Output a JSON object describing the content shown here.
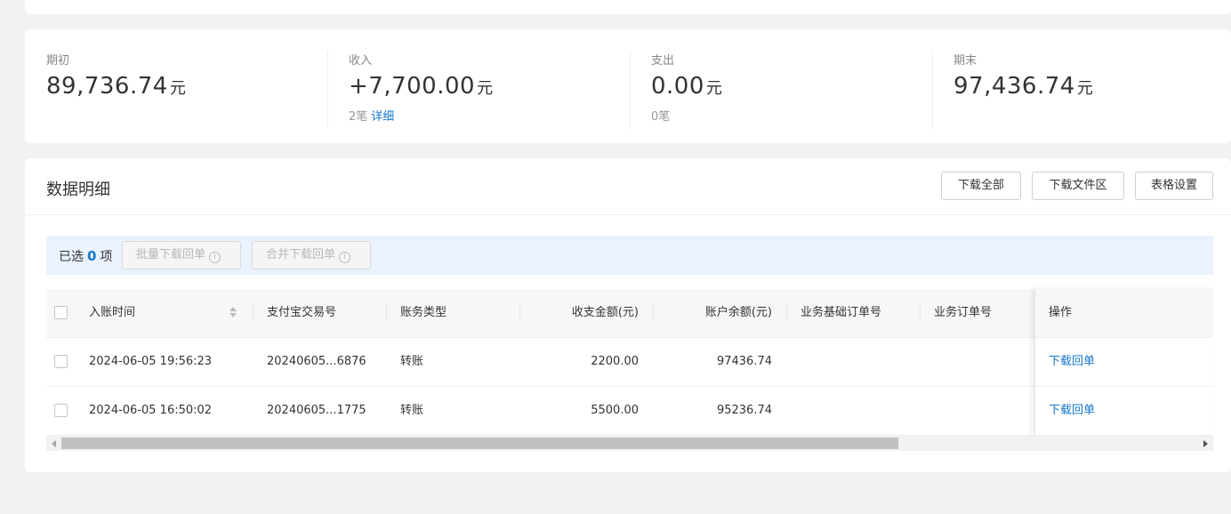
{
  "summary": [
    {
      "label": "期初",
      "amount": "89,736.74",
      "unit": "元",
      "sub_count": "",
      "sub_link": ""
    },
    {
      "label": "收入",
      "amount": "+7,700.00",
      "unit": "元",
      "sub_count": "2笔",
      "sub_link": "详细"
    },
    {
      "label": "支出",
      "amount": "0.00",
      "unit": "元",
      "sub_count": "0笔",
      "sub_link": ""
    },
    {
      "label": "期末",
      "amount": "97,436.74",
      "unit": "元",
      "sub_count": "",
      "sub_link": ""
    }
  ],
  "detail": {
    "title": "数据明细",
    "buttons": {
      "download_all": "下载全部",
      "download_files": "下载文件区",
      "table_settings": "表格设置"
    }
  },
  "selection": {
    "prefix": "已选",
    "count": "0",
    "suffix": "项",
    "batch_download": "批量下载回单",
    "merge_download": "合并下载回单",
    "info_icon": "info-circle-icon"
  },
  "table": {
    "headers": {
      "time": "入账时间",
      "alipay_no": "支付宝交易号",
      "type": "账务类型",
      "amount": "收支金额(元)",
      "balance": "账户余额(元)",
      "base_order": "业务基础订单号",
      "order": "业务订单号",
      "action": "操作"
    },
    "rows": [
      {
        "time": "2024-06-05 19:56:23",
        "alipay_no": "20240605...6876",
        "type": "转账",
        "amount": "2200.00",
        "balance": "97436.74",
        "base_order": "",
        "order": "",
        "action": "下载回单"
      },
      {
        "time": "2024-06-05 16:50:02",
        "alipay_no": "20240605...1775",
        "type": "转账",
        "amount": "5500.00",
        "balance": "95236.74",
        "base_order": "",
        "order": "",
        "action": "下载回单"
      }
    ]
  },
  "colors": {
    "accent": "#1677c9",
    "selection_bg": "#eaf2fd"
  }
}
